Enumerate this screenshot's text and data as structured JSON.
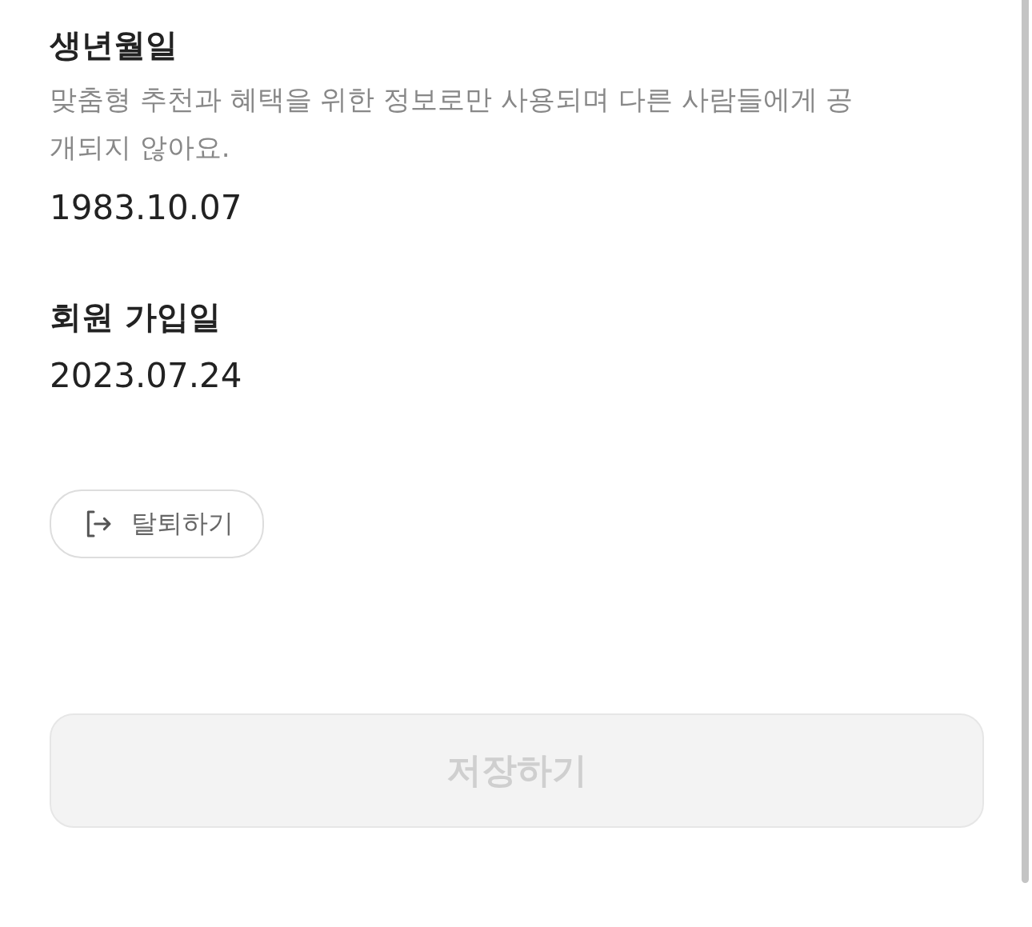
{
  "sections": [
    {
      "title": "생년월일",
      "description": "맞춤형 추천과 혜택을 위한 정보로만 사용되며 다른 사람들에게 공개되지 않아요.",
      "value": "1983.10.07"
    },
    {
      "title": "회원 가입일",
      "value": "2023.07.24"
    }
  ],
  "withdraw_button": {
    "label": "탈퇴하기"
  },
  "save_button": {
    "label": "저장하기",
    "disabled": true
  }
}
